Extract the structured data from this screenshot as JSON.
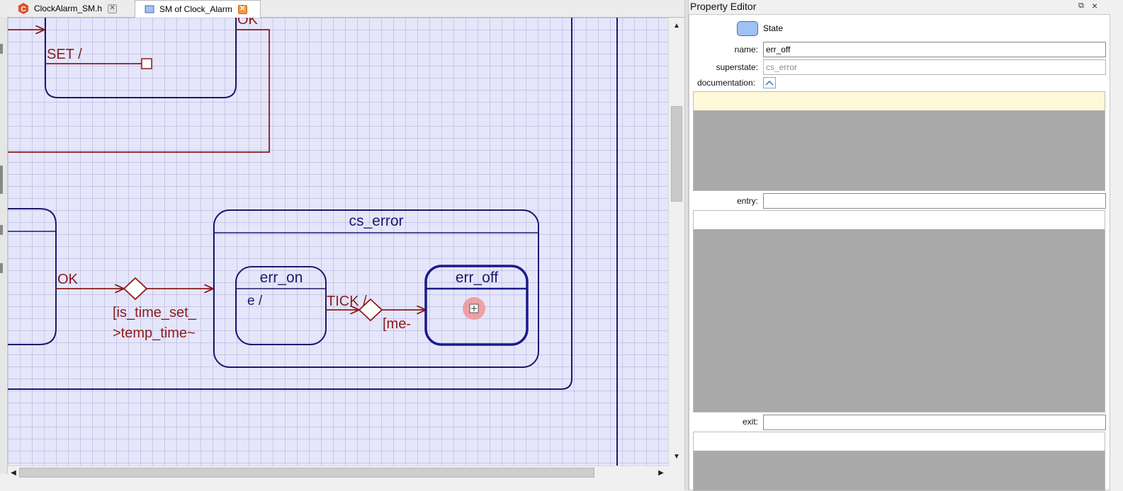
{
  "tabs": [
    {
      "label": "ClockAlarm_SM.h",
      "icon": "c-file-icon",
      "close": "grey"
    },
    {
      "label": "SM of Clock_Alarm",
      "icon": "diagram-icon",
      "close": "orange"
    }
  ],
  "diagram": {
    "states": {
      "cs_error": "cs_error",
      "err_on": "err_on",
      "err_off": "err_off"
    },
    "labels": {
      "set": "SET /",
      "ok_top": "OK",
      "ok": "OK",
      "guard_line1": "[is_time_set_",
      "guard_line2": ">temp_time~",
      "tick": "TICK /",
      "me_guard": "[me-",
      "entry_action": "e /"
    },
    "colors": {
      "state_border": "#1a1a6e",
      "state_text": "#1a1a6e",
      "transition": "#8b1a1a",
      "canvas_bg": "#e6e6fa",
      "selection_marker": "#f08a8a"
    }
  },
  "property_editor": {
    "title": "Property Editor",
    "type_label": "State",
    "name_label": "name:",
    "name_value": "err_off",
    "superstate_label": "superstate:",
    "superstate_value": "cs_error",
    "documentation_label": "documentation:",
    "entry_label": "entry:",
    "exit_label": "exit:",
    "colors": {
      "doc_highlight": "#fff8d9",
      "code_area": "#a9a9a9"
    }
  }
}
